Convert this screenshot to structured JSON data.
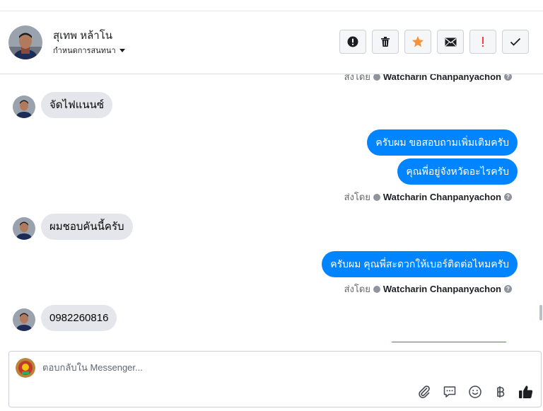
{
  "header": {
    "contact_name": "สุเทพ หล้าโน",
    "conversation_settings": "กำหนดการสนทนา",
    "toolbar": [
      {
        "name": "mark-spam",
        "icon": "exclamation-circle-icon"
      },
      {
        "name": "delete",
        "icon": "trash-icon"
      },
      {
        "name": "star",
        "icon": "star-icon",
        "color": "#f7923b"
      },
      {
        "name": "mark-unread",
        "icon": "envelope-icon"
      },
      {
        "name": "important",
        "icon": "exclamation-icon",
        "color": "#fa3e3e"
      },
      {
        "name": "done",
        "icon": "check-icon"
      }
    ]
  },
  "messages": {
    "m1": {
      "direction": "incoming",
      "text": "จัดไฟแนนซ์"
    },
    "m2": {
      "direction": "outgoing",
      "text": "ครับผม ขอสอบถามเพิ่มเติมครับ"
    },
    "m3": {
      "direction": "outgoing",
      "text": "คุณพี่อยู่จังหวัดอะไรครับ"
    },
    "m4": {
      "direction": "incoming",
      "text": "ผมชอบคันนี้ครับ"
    },
    "m5": {
      "direction": "outgoing",
      "text": "ครับผม คุณพี่สะดวกให้เบอร์ติดต่อไหมครับ"
    },
    "m6": {
      "direction": "incoming",
      "text": "0982260816"
    }
  },
  "sent_by": {
    "prefix": "ส่งโดย",
    "name": "Watcharin Chanpanyachon"
  },
  "composer": {
    "placeholder": "ตอบกลับใน Messenger...",
    "icons": [
      "paperclip-icon",
      "saved-reply-icon",
      "emoji-icon",
      "baht-icon",
      "thumbs-up-icon"
    ]
  },
  "colors": {
    "outgoing_bubble": "#0084ff",
    "incoming_bubble": "#e4e6eb",
    "accent_star": "#f7923b",
    "accent_important": "#fa3e3e"
  }
}
